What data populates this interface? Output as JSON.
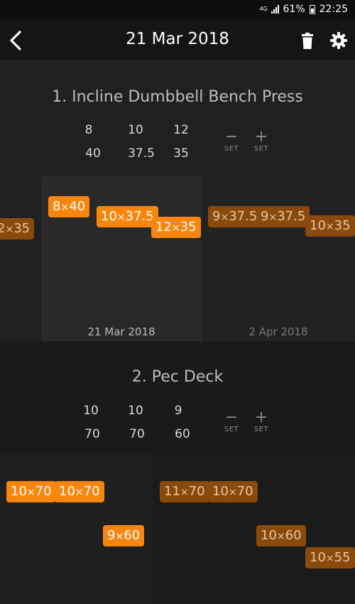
{
  "status": {
    "network": "4G",
    "battery": "61%",
    "time": "22:25"
  },
  "toolbar": {
    "title": "21 Mar 2018"
  },
  "exercises": [
    {
      "title": "1. Incline Dumbbell Bench Press",
      "reps": [
        "8",
        "10",
        "12"
      ],
      "weights": [
        "40",
        "37.5",
        "35"
      ],
      "minus_set": "SET",
      "plus_set": "SET",
      "left_chip": {
        "reps": "2",
        "weight": "35"
      },
      "current": {
        "date": "21 Mar 2018",
        "chips": [
          {
            "reps": "8",
            "weight": "40"
          },
          {
            "reps": "10",
            "weight": "37.5"
          },
          {
            "reps": "12",
            "weight": "35"
          }
        ]
      },
      "previous": {
        "date": "2 Apr 2018",
        "chips": [
          {
            "reps": "9",
            "weight": "37.5"
          },
          {
            "reps": "9",
            "weight": "37.5"
          },
          {
            "reps": "10",
            "weight": "35"
          }
        ]
      }
    },
    {
      "title": "2. Pec Deck",
      "reps": [
        "10",
        "10",
        "9"
      ],
      "weights": [
        "70",
        "70",
        "60"
      ],
      "minus_set": "SET",
      "plus_set": "SET",
      "current": {
        "chips": [
          {
            "reps": "10",
            "weight": "70"
          },
          {
            "reps": "10",
            "weight": "70"
          },
          {
            "reps": "9",
            "weight": "60"
          }
        ]
      },
      "previous": {
        "chips": [
          {
            "reps": "11",
            "weight": "70"
          },
          {
            "reps": "10",
            "weight": "70"
          },
          {
            "reps": "10",
            "weight": "60"
          },
          {
            "reps": "10",
            "weight": "55"
          }
        ]
      }
    }
  ],
  "colors": {
    "current_chip": "#f7860f",
    "previous_chip": "#8a4a0c",
    "background": "#1c1c1c"
  },
  "icons": {
    "back": "back-arrow-icon",
    "delete": "trash-icon",
    "settings": "gear-icon"
  }
}
